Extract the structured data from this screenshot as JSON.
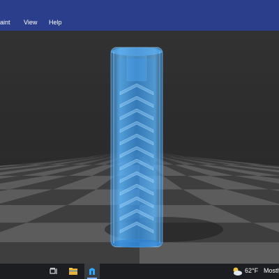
{
  "menubar": {
    "items": [
      {
        "label": "aint"
      },
      {
        "label": "View"
      },
      {
        "label": "Help"
      }
    ]
  },
  "viewport": {
    "model_color": "#3aa0ff",
    "floor_light": "#5c5c5c",
    "floor_dark": "#3e3e3e"
  },
  "taskbar": {
    "icons": [
      {
        "name": "task-view-icon"
      },
      {
        "name": "file-explorer-icon"
      },
      {
        "name": "3d-viewer-app-icon"
      }
    ],
    "weather": {
      "temperature": "62°F",
      "condition": "Mostly c"
    }
  }
}
